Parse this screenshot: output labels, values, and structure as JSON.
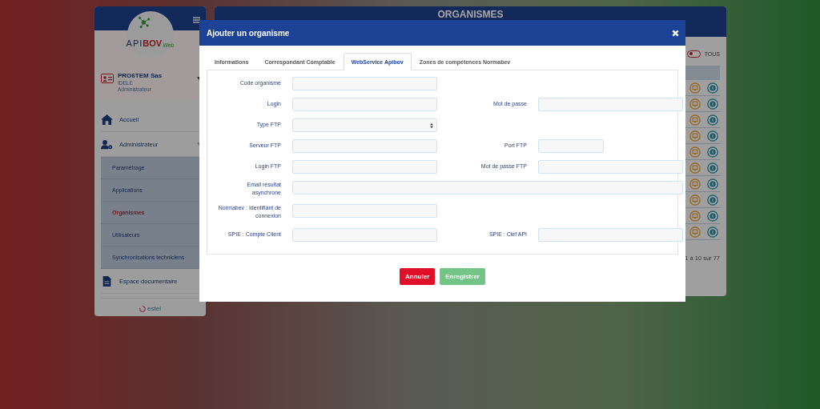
{
  "sidebar": {
    "logo": {
      "prefix": "API",
      "brand": "BOV",
      "suffix": "Web"
    },
    "user": {
      "name": "PRO6TEM Sas",
      "organization": "IDELE",
      "role": "Administrateur"
    },
    "items": [
      {
        "label": "Accueil",
        "kind": "home"
      },
      {
        "label": "Administrateur",
        "kind": "admin",
        "expanded": true,
        "children": [
          {
            "label": "Paramétrage",
            "selected": false
          },
          {
            "label": "Applications",
            "selected": false
          },
          {
            "label": "Organismes",
            "selected": true
          },
          {
            "label": "Utilisateurs",
            "selected": false
          },
          {
            "label": "Synchronisations techniciens",
            "selected": false
          }
        ]
      },
      {
        "label": "Espace documentaire",
        "kind": "document"
      }
    ],
    "footer_logo": "estel"
  },
  "main": {
    "title": "ORGANISMES",
    "filter_all": {
      "label": "TOUS",
      "on": false
    },
    "pagination": "1 à 10 sur 77"
  },
  "modal": {
    "title": "Ajouter un organisme",
    "tabs": [
      {
        "label": "Informations",
        "selected": false
      },
      {
        "label": "Correspondant Comptable",
        "selected": false
      },
      {
        "label": "WebService Apibov",
        "selected": true
      },
      {
        "label": "Zones de compétences Normabev",
        "selected": false
      }
    ],
    "rows": [
      {
        "fields": [
          {
            "label": "Code organisme",
            "kind": "text"
          }
        ]
      },
      {
        "fields": [
          {
            "label": "Login",
            "kind": "text"
          },
          {
            "label": "Mot de passe",
            "kind": "text"
          }
        ]
      },
      {
        "fields": [
          {
            "label": "Type FTP",
            "kind": "select"
          }
        ]
      },
      {
        "fields": [
          {
            "label": "Serveur FTP",
            "kind": "text"
          },
          {
            "label": "Port FTP",
            "kind": "short"
          }
        ]
      },
      {
        "fields": [
          {
            "label": "Login FTP",
            "kind": "text"
          },
          {
            "label": "Mot de passe FTP",
            "kind": "text"
          }
        ]
      },
      {
        "fields": [
          {
            "label": "Email résultat asynchrone",
            "kind": "wide"
          }
        ]
      },
      {
        "fields": [
          {
            "label": "Normabev : Identifiant de connexion",
            "kind": "text"
          }
        ]
      },
      {
        "fields": [
          {
            "label": "SPIE : Compte Client",
            "kind": "text"
          },
          {
            "label": "SPIE : Clef API",
            "kind": "text"
          }
        ]
      }
    ],
    "buttons": [
      {
        "label": "Annuler",
        "kind": "danger",
        "disabled": false
      },
      {
        "label": "Enregistrer",
        "kind": "success",
        "disabled": true
      }
    ]
  }
}
